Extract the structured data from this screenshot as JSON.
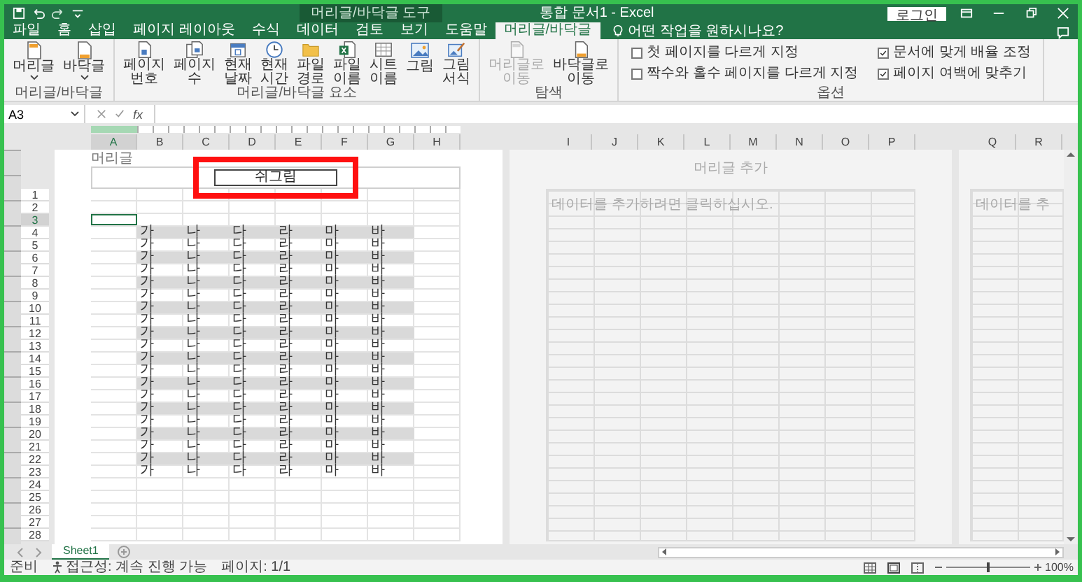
{
  "title_bar": {
    "context_label": "머리글/바닥글 도구",
    "title": "통합 문서1 - Excel",
    "sign_in": "로그인"
  },
  "tabs": [
    {
      "label": "파일",
      "selected": false
    },
    {
      "label": "홈",
      "selected": false
    },
    {
      "label": "삽입",
      "selected": false
    },
    {
      "label": "페이지 레이아웃",
      "selected": false
    },
    {
      "label": "수식",
      "selected": false
    },
    {
      "label": "데이터",
      "selected": false
    },
    {
      "label": "검토",
      "selected": false
    },
    {
      "label": "보기",
      "selected": false
    },
    {
      "label": "도움말",
      "selected": false
    },
    {
      "label": "머리글/바닥글",
      "selected": true
    }
  ],
  "tell_me": {
    "placeholder": "어떤 작업을 원하시나요?"
  },
  "ribbon": {
    "groups": [
      {
        "label": "머리글/바닥글",
        "kind": "buttons",
        "buttons": [
          {
            "lines": [
              "머리글"
            ],
            "disabled": false
          },
          {
            "lines": [
              "바닥글"
            ],
            "disabled": false
          }
        ]
      },
      {
        "label": "머리글/바닥글 요소",
        "kind": "buttons",
        "buttons": [
          {
            "lines": [
              "페이지",
              "번호"
            ],
            "disabled": false
          },
          {
            "lines": [
              "페이지",
              "수"
            ],
            "disabled": false
          },
          {
            "lines": [
              "현재",
              "날짜"
            ],
            "disabled": false
          },
          {
            "lines": [
              "현재",
              "시간"
            ],
            "disabled": false
          },
          {
            "lines": [
              "파일",
              "경로"
            ],
            "disabled": false
          },
          {
            "lines": [
              "파일",
              "이름"
            ],
            "disabled": false
          },
          {
            "lines": [
              "시트",
              "이름"
            ],
            "disabled": false
          },
          {
            "lines": [
              "그림"
            ],
            "disabled": false
          },
          {
            "lines": [
              "그림",
              "서식"
            ],
            "disabled": false
          }
        ]
      },
      {
        "label": "탐색",
        "kind": "buttons",
        "buttons": [
          {
            "lines": [
              "머리글로",
              "이동"
            ],
            "disabled": true
          },
          {
            "lines": [
              "바닥글로",
              "이동"
            ],
            "disabled": false
          }
        ]
      },
      {
        "label": "옵션",
        "kind": "checks",
        "options": [
          {
            "label": "첫 페이지를 다르게 지정",
            "checked": false
          },
          {
            "label": "짝수와 홀수 페이지를 다르게 지정",
            "checked": false
          },
          {
            "label": "문서에 맞게 배율 조정",
            "checked": true
          },
          {
            "label": "페이지 여백에 맞추기",
            "checked": true
          }
        ]
      }
    ]
  },
  "formula_bar": {
    "name_box": "A3",
    "function_label": "fx"
  },
  "sheet": {
    "columns": [
      {
        "label": "A",
        "selected": true
      },
      {
        "label": "B",
        "selected": false
      },
      {
        "label": "C",
        "selected": false
      },
      {
        "label": "D",
        "selected": false
      },
      {
        "label": "E",
        "selected": false
      },
      {
        "label": "F",
        "selected": false
      },
      {
        "label": "G",
        "selected": false
      },
      {
        "label": "H",
        "selected": false
      }
    ],
    "header_label": "머리글",
    "header_text": "쉬그림",
    "header_highlighted": true,
    "rows": [
      {
        "number": "1",
        "selected": false
      },
      {
        "number": "2",
        "selected": false
      },
      {
        "number": "3",
        "selected": true
      },
      {
        "number": "4",
        "selected": false,
        "shaded": true,
        "cells": [
          "가",
          "나",
          "다",
          "라",
          "마",
          "바"
        ]
      },
      {
        "number": "5",
        "selected": false,
        "shaded": false,
        "cells": [
          "가",
          "나",
          "다",
          "라",
          "마",
          "바"
        ]
      },
      {
        "number": "6",
        "selected": false,
        "shaded": true,
        "cells": [
          "가",
          "나",
          "다",
          "라",
          "마",
          "바"
        ]
      },
      {
        "number": "7",
        "selected": false,
        "shaded": false,
        "cells": [
          "가",
          "나",
          "다",
          "라",
          "마",
          "바"
        ]
      },
      {
        "number": "8",
        "selected": false,
        "shaded": true,
        "cells": [
          "가",
          "나",
          "다",
          "라",
          "마",
          "바"
        ]
      },
      {
        "number": "9",
        "selected": false,
        "shaded": false,
        "cells": [
          "가",
          "나",
          "다",
          "라",
          "마",
          "바"
        ]
      },
      {
        "number": "10",
        "selected": false,
        "shaded": true,
        "cells": [
          "가",
          "나",
          "다",
          "라",
          "마",
          "바"
        ]
      },
      {
        "number": "11",
        "selected": false,
        "shaded": false,
        "cells": [
          "가",
          "나",
          "다",
          "라",
          "마",
          "바"
        ]
      },
      {
        "number": "12",
        "selected": false,
        "shaded": true,
        "cells": [
          "가",
          "나",
          "다",
          "라",
          "마",
          "바"
        ]
      },
      {
        "number": "13",
        "selected": false,
        "shaded": false,
        "cells": [
          "가",
          "나",
          "다",
          "라",
          "마",
          "바"
        ]
      },
      {
        "number": "14",
        "selected": false,
        "shaded": true,
        "cells": [
          "가",
          "나",
          "다",
          "라",
          "마",
          "바"
        ]
      },
      {
        "number": "15",
        "selected": false,
        "shaded": false,
        "cells": [
          "가",
          "나",
          "다",
          "라",
          "마",
          "바"
        ]
      },
      {
        "number": "16",
        "selected": false,
        "shaded": true,
        "cells": [
          "가",
          "나",
          "다",
          "라",
          "마",
          "바"
        ]
      },
      {
        "number": "17",
        "selected": false,
        "shaded": false,
        "cells": [
          "가",
          "나",
          "다",
          "라",
          "마",
          "바"
        ]
      },
      {
        "number": "18",
        "selected": false,
        "shaded": true,
        "cells": [
          "가",
          "나",
          "다",
          "라",
          "마",
          "바"
        ]
      },
      {
        "number": "19",
        "selected": false,
        "shaded": false,
        "cells": [
          "가",
          "나",
          "다",
          "라",
          "마",
          "바"
        ]
      },
      {
        "number": "20",
        "selected": false,
        "shaded": true,
        "cells": [
          "가",
          "나",
          "다",
          "라",
          "마",
          "바"
        ]
      },
      {
        "number": "21",
        "selected": false,
        "shaded": false,
        "cells": [
          "가",
          "나",
          "다",
          "라",
          "마",
          "바"
        ]
      },
      {
        "number": "22",
        "selected": false,
        "shaded": true,
        "cells": [
          "가",
          "나",
          "다",
          "라",
          "마",
          "바"
        ]
      },
      {
        "number": "23",
        "selected": false,
        "shaded": false,
        "cells": [
          "가",
          "나",
          "다",
          "라",
          "마",
          "바"
        ]
      },
      {
        "number": "24",
        "selected": false
      },
      {
        "number": "25",
        "selected": false
      },
      {
        "number": "26",
        "selected": false
      },
      {
        "number": "27",
        "selected": false
      },
      {
        "number": "28",
        "selected": false
      }
    ]
  },
  "page_2": {
    "columns": [
      "I",
      "J",
      "K",
      "L",
      "M",
      "N",
      "O",
      "P"
    ],
    "header_prompt": "머리글 추가",
    "data_prompt": "데이터를 추가하려면 클릭하십시오."
  },
  "page_3": {
    "columns": [
      "Q",
      "R"
    ],
    "data_prompt": "데이터를 추"
  },
  "sheet_tabs": [
    {
      "label": "Sheet1",
      "selected": true
    }
  ],
  "status_bar": {
    "ready": "준비",
    "accessibility": "접근성: 계속 진행 가능",
    "page": "페이지: 1/1",
    "zoom": {
      "level": 0.5
    },
    "zoom_percent": "100%"
  }
}
